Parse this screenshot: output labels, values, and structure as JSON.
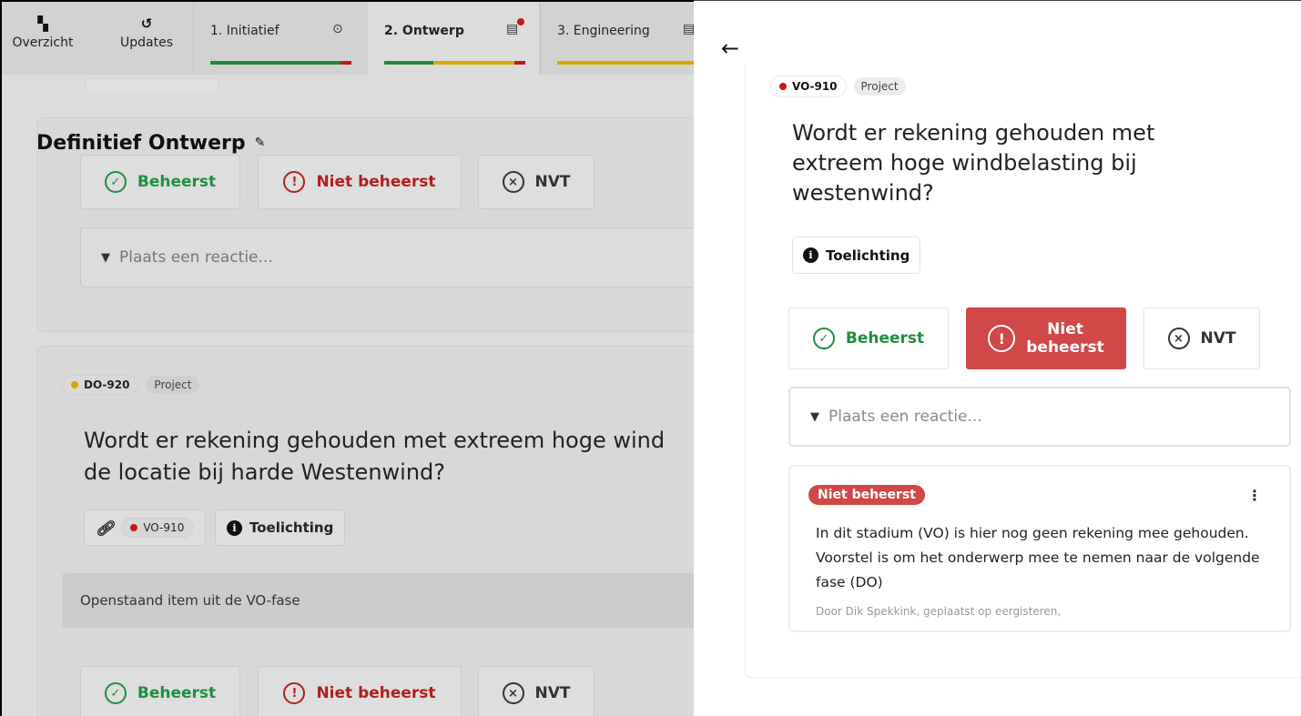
{
  "topbar": {
    "overview_label": "Overzicht",
    "updates_label": "Updates",
    "tabs": [
      {
        "label": "1. Initiatief",
        "status_icon": "check-circle-icon"
      },
      {
        "label": "2. Ontwerp",
        "status_icon": "clipboard-icon",
        "has_notification": true
      },
      {
        "label": "3. Engineering",
        "status_icon": "clipboard-icon"
      }
    ]
  },
  "page": {
    "title": "Definitief Ontwerp"
  },
  "first_card": {
    "choices": {
      "managed": "Beheerst",
      "not_managed": "Niet beheerst",
      "na": "NVT"
    },
    "comment_placeholder": "Plaats een reactie..."
  },
  "second_card": {
    "id": "DO-920",
    "status_color": "#d9a800",
    "tag": "Project",
    "question": "Wordt er rekening gehouden met extreem hoge wind",
    "question_line2": "de locatie bij harde Westenwind?",
    "linked_id": "VO-910",
    "explain_label": "Toelichting",
    "note": "Openstaand item uit de VO-fase",
    "choices": {
      "managed": "Beheerst",
      "not_managed": "Niet beheerst",
      "na": "NVT"
    }
  },
  "panel": {
    "id": "VO-910",
    "status_color": "#c21818",
    "tag": "Project",
    "question": "Wordt er rekening gehouden met extreem hoge windbelasting bij westenwind?",
    "explain_label": "Toelichting",
    "choices": {
      "managed": "Beheerst",
      "not_managed_line1": "Niet",
      "not_managed_line2": "beheerst",
      "na": "NVT"
    },
    "selected_choice": "not_managed",
    "comment_placeholder": "Plaats een reactie...",
    "comment": {
      "badge": "Niet beheerst",
      "text": "In dit stadium (VO) is hier nog geen rekening mee gehouden. Voorstel is om het onderwerp mee te nemen naar de volgende fase (DO)",
      "meta": "Door Dik Spekkink, geplaatst op eergisteren,"
    }
  },
  "colors": {
    "green": "#1f8f3f",
    "red": "#b21e1e",
    "danger_bg": "#d04848",
    "progress_green": "#1e8a3c",
    "progress_red": "#c21818",
    "progress_yellow": "#d9a800"
  }
}
